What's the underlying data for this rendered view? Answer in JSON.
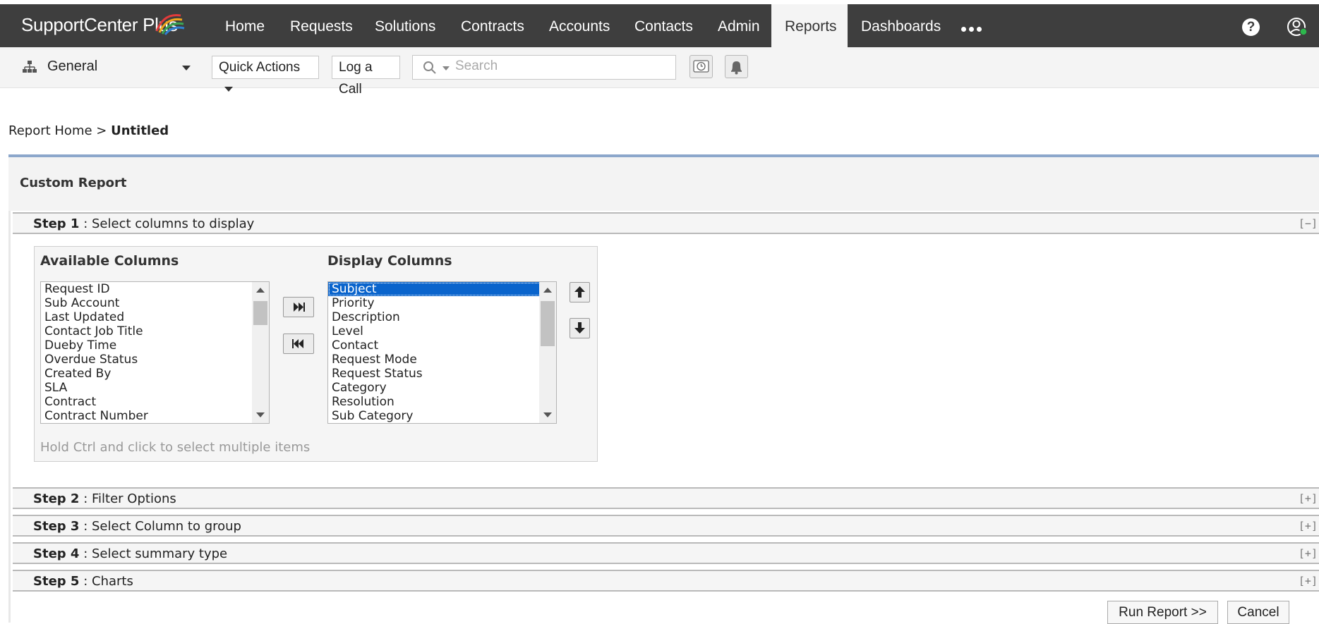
{
  "app": {
    "logo_text": "SupportCenter",
    "logo_plus": "Plus"
  },
  "nav": {
    "items": [
      {
        "label": "Home"
      },
      {
        "label": "Requests"
      },
      {
        "label": "Solutions"
      },
      {
        "label": "Contracts"
      },
      {
        "label": "Accounts"
      },
      {
        "label": "Contacts"
      },
      {
        "label": "Admin"
      },
      {
        "label": "Reports",
        "active": true
      },
      {
        "label": "Dashboards"
      }
    ],
    "more_icon": "ellipsis-icon",
    "help_icon": "question-icon",
    "user_icon": "user-avatar-icon"
  },
  "toolbar": {
    "site_selector": "General",
    "quick_actions": "Quick Actions",
    "log_call": "Log a Call",
    "search_placeholder": "Search",
    "reminder_icon": "clock-icon",
    "notification_icon": "bell-icon"
  },
  "breadcrumb": {
    "home": "Report Home",
    "separator": ">",
    "current": "Untitled"
  },
  "report": {
    "title": "Custom Report",
    "steps": [
      {
        "num": "Step 1",
        "sep": ":",
        "text": "Select columns to display",
        "toggle": "[−]",
        "expanded": true
      },
      {
        "num": "Step 2",
        "sep": ":",
        "text": "Filter Options",
        "toggle": "[+]"
      },
      {
        "num": "Step 3",
        "sep": ":",
        "text": "Select Column to group",
        "toggle": "[+]"
      },
      {
        "num": "Step 4",
        "sep": ":",
        "text": "Select summary type",
        "toggle": "[+]"
      },
      {
        "num": "Step 5",
        "sep": ":",
        "text": "Charts",
        "toggle": "[+]"
      }
    ],
    "available_header": "Available Columns",
    "display_header": "Display Columns",
    "available_columns": [
      "Request ID",
      "Sub Account",
      "Last Updated",
      "Contact Job Title",
      "Dueby Time",
      "Overdue Status",
      "Created By",
      "SLA",
      "Contract",
      "Contract Number"
    ],
    "display_columns": [
      "Subject",
      "Priority",
      "Description",
      "Level",
      "Contact",
      "Request Mode",
      "Request Status",
      "Category",
      "Resolution",
      "Sub Category"
    ],
    "display_selected": "Subject",
    "hint": "Hold Ctrl and click to select multiple items",
    "run_button": "Run Report >>",
    "cancel_button": "Cancel"
  },
  "colors": {
    "nav_bg": "#3e3e3e",
    "active_tab_bg": "#f4f4f4",
    "selection": "#0a64cc",
    "panel_accent": "#8ca7cb",
    "status_online": "#2db84d"
  }
}
